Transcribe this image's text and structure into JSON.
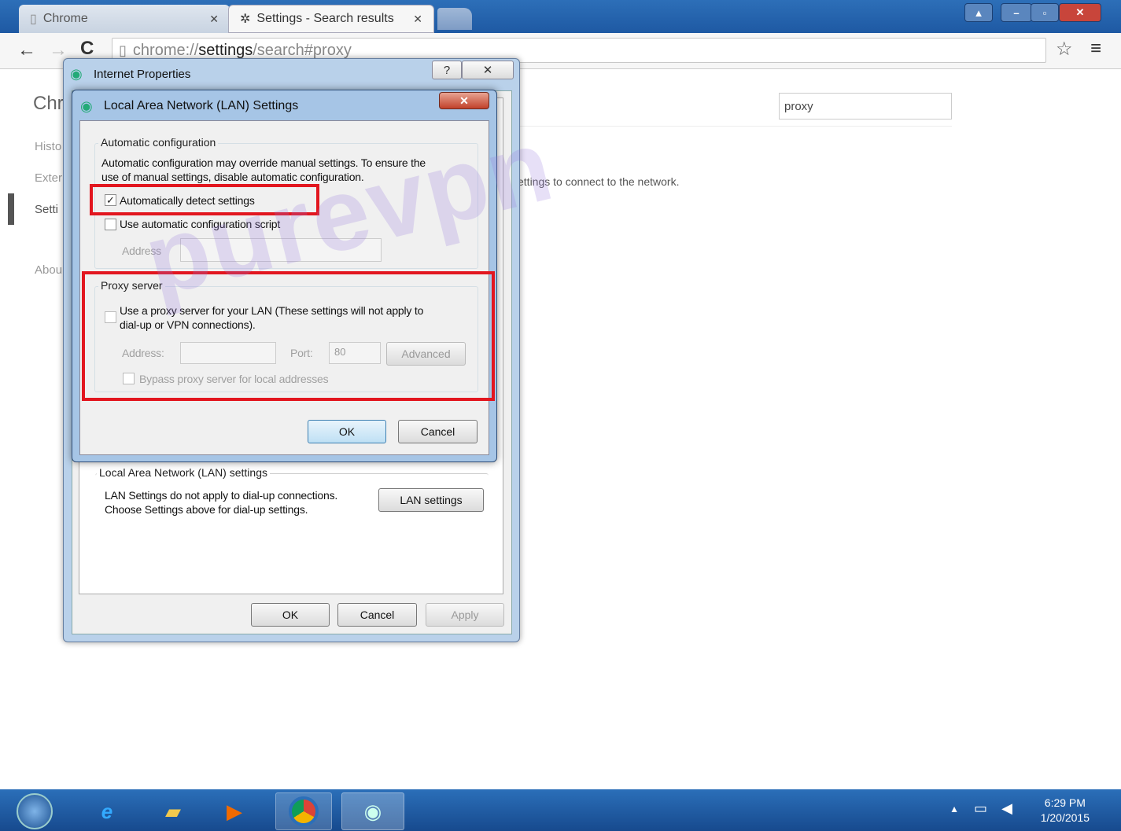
{
  "browser": {
    "tabs": [
      {
        "label": "Chrome",
        "icon": "page-icon"
      },
      {
        "label": "Settings - Search results",
        "icon": "gear-icon"
      }
    ],
    "url": {
      "scheme": "chrome://",
      "host": "settings",
      "path": "/search#proxy"
    }
  },
  "settings_page": {
    "title_partial": "Chr",
    "nav": [
      "Histo",
      "Exter",
      "Setti",
      "Abou"
    ],
    "search_value": "proxy",
    "network_note": "ettings to connect to the network."
  },
  "watermark": "purevpn",
  "internet_properties": {
    "title": "Internet Properties",
    "help_label": "?",
    "close_label": "✕",
    "lan_group_label": "Local Area Network (LAN) settings",
    "lan_note_1": "LAN Settings do not apply to dial-up connections.",
    "lan_note_2": "Choose Settings above for dial-up settings.",
    "lan_button": "LAN settings",
    "ok": "OK",
    "cancel": "Cancel",
    "apply": "Apply"
  },
  "lan_dialog": {
    "title": "Local Area Network (LAN) Settings",
    "close_label": "✕",
    "auto_group": "Automatic configuration",
    "auto_desc_1": "Automatic configuration may override manual settings.  To ensure the",
    "auto_desc_2": "use of manual settings, disable automatic configuration.",
    "auto_detect": {
      "label": "Automatically detect settings",
      "checked": true
    },
    "auto_script": {
      "label": "Use automatic configuration script",
      "checked": false
    },
    "address_label": "Address",
    "proxy_group": "Proxy server",
    "proxy_use_1": "Use a proxy server for your LAN (These settings will not apply to",
    "proxy_use_2": "dial-up or VPN connections).",
    "proxy_address_label": "Address:",
    "port_label": "Port:",
    "port_value": "80",
    "advanced": "Advanced",
    "bypass": "Bypass proxy server for local addresses",
    "ok": "OK",
    "cancel": "Cancel"
  },
  "taskbar": {
    "time": "6:29 PM",
    "date": "1/20/2015"
  }
}
